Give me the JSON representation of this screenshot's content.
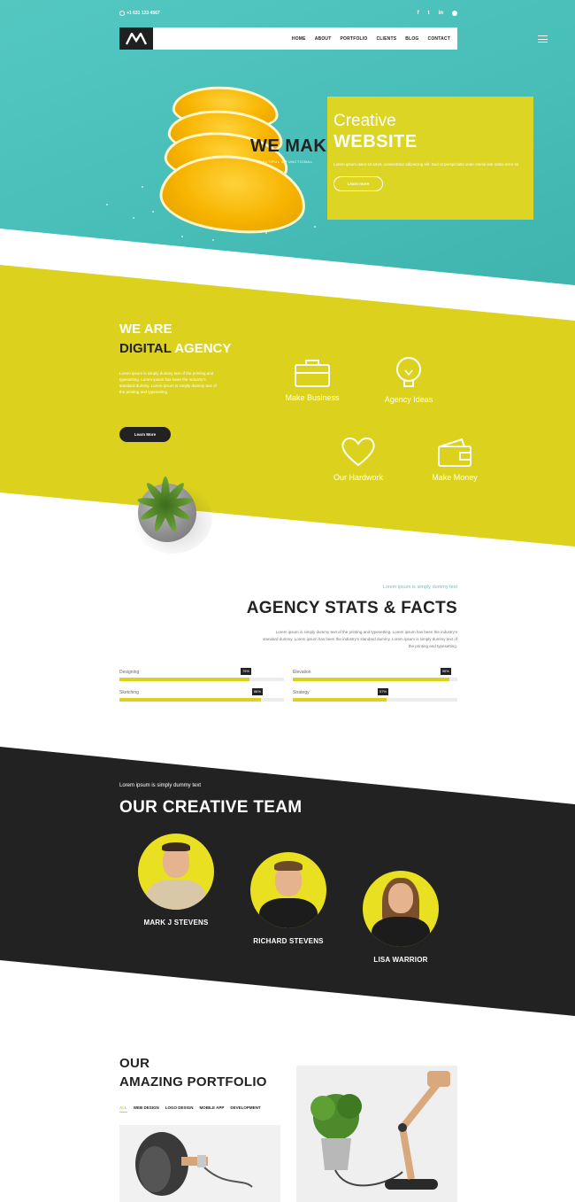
{
  "topbar": {
    "phone": "+1 631 123 4567",
    "social_icons": [
      "facebook-icon",
      "twitter-icon",
      "linkedin-icon",
      "dribbble-icon"
    ]
  },
  "nav": {
    "items": [
      "HOME",
      "ABOUT",
      "PORTFOLIO",
      "CLIENTS",
      "BLOG",
      "CONTACT"
    ]
  },
  "hero": {
    "we_make": "WE MAKE",
    "we_make_sub": "BEAUTIFUL & FUNCTIONAL",
    "creative": "Creative",
    "website": "WEBSITE",
    "description": "Lorem ipsum dolor sit amet, consectetur adipiscing elit. Sed ut perspiciatis unde omnis iste natus error sit",
    "button": "Learn more"
  },
  "agency": {
    "line1": "WE ARE",
    "line2a": "DIGITAL",
    "line2b": " AGENCY",
    "description": "Lorem ipsum is simply dummy text of the printing and typesetting. Lorem ipsum has been the industry's standard dummy. Lorem ipsum is simply dummy text of the printing and typesetting",
    "button": "Learn More",
    "features": [
      "Make Business",
      "Agency Ideas",
      "Our Hardwork",
      "Make Money"
    ]
  },
  "stats": {
    "kicker": "Lorem ipsum is simply dummy text",
    "title": "AGENCY STATS & FACTS",
    "description": "Lorem ipsum is simply dummy text of the printing and typesetting. Lorem ipsum has been the industry's standard dummy. Lorem ipsum has been the industry's standard dummy. Lorem ipsum is simply dummy text of the printing and typesetting.",
    "bars": [
      {
        "name": "Designing",
        "value": 79,
        "label": "79%"
      },
      {
        "name": "Elevation",
        "value": 95,
        "label": "95%"
      },
      {
        "name": "Sketching",
        "value": 86,
        "label": "86%"
      },
      {
        "name": "Strategy",
        "value": 57,
        "label": "57%"
      }
    ],
    "accent": "#dcd21e"
  },
  "team": {
    "kicker": "Lorem ipsum is simply dummy text",
    "title": "OUR CREATIVE TEAM",
    "members": [
      "MARK J STEVENS",
      "RICHARD STEVENS",
      "LISA WARRIOR"
    ]
  },
  "portfolio": {
    "line1": "OUR",
    "line2": "AMAZING PORTFOLIO",
    "tabs": [
      "ALL",
      "WEB DESIGN",
      "LOGO DESIGN",
      "MOBILE APP",
      "DEVELOPMENT"
    ]
  },
  "colors": {
    "teal": "#4fc3bd",
    "yellow": "#dcd21e",
    "dark": "#222222"
  }
}
